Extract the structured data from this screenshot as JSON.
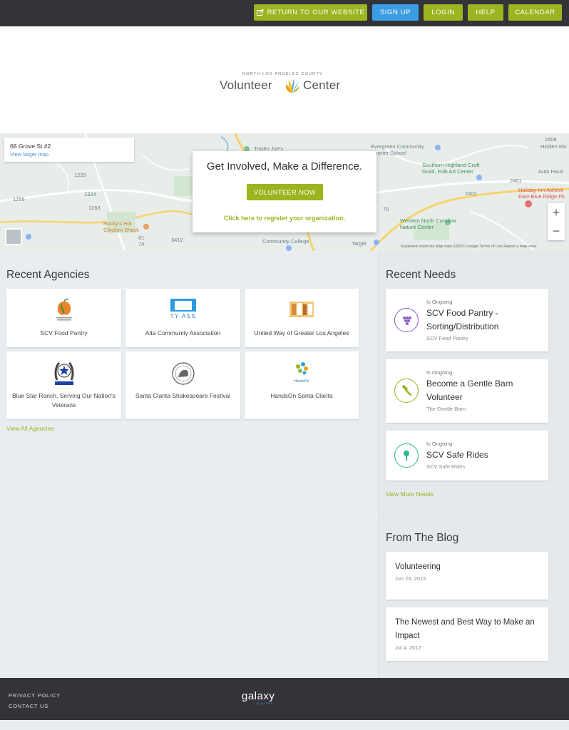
{
  "topbar": {
    "return_label": "RETURN TO OUR WEBSITE",
    "signup_label": "SIGN UP",
    "login_label": "LOGIN",
    "help_label": "HELP",
    "calendar_label": "CALENDAR"
  },
  "logo": {
    "small": "NORTH LOS ANGELES COUNTY",
    "part1": "Volunteer",
    "part2": "Center"
  },
  "map": {
    "address": "68 Grove St #2",
    "view_larger": "View larger map",
    "labels": {
      "trader": "Trader Joe's",
      "evergreen": "Evergreen Community Charter School",
      "southern": "Southern Highland Craft Guild, Folk Art Center",
      "auto": "Auto Haus",
      "hidden": "Hidden Riv",
      "holiday": "Holiday Inn Ashevil East-Blue Ridge Pk",
      "western": "Western North Carolina Nature Center",
      "rocky": "Rocky's Hot Chicken Shack",
      "community": "Community College",
      "target": "Target",
      "r1229": "1229",
      "r1324": "1324",
      "r1263": "1263",
      "r1255": "1255",
      "r3412": "3412",
      "r2408": "2408",
      "r2402": "2402",
      "r2401": "2401",
      "r70": "70",
      "r74": "74",
      "r81": "81"
    },
    "footer": "Keyboard shortcuts    Map data ©2023 Google    Terms of Use    Report a map error",
    "zoom_in": "+",
    "zoom_out": "−"
  },
  "cta": {
    "title": "Get Involved, Make a Difference.",
    "button": "VOLUNTEER NOW",
    "link": "Click here to register your organization."
  },
  "agencies": {
    "heading": "Recent Agencies",
    "items": [
      {
        "name": "SCV Food Pantry",
        "logo_text": "SCV FOOD PANTRY"
      },
      {
        "name": "Alta Community Association",
        "logo_text": "TY ASS"
      },
      {
        "name": "United Way of Greater Los Angeles",
        "logo_text": ""
      },
      {
        "name": "Blue Star Ranch, Serving Our Nation's Veterans",
        "logo_text": ""
      },
      {
        "name": "Santa Clarita Shakespeare Festival",
        "logo_text": ""
      },
      {
        "name": "HandsOn Santa Clarita",
        "logo_text": "HandsOn"
      }
    ],
    "view_all": "View All Agencies"
  },
  "needs": {
    "heading": "Recent Needs",
    "items": [
      {
        "status": "Is Ongoing",
        "name": "SCV Food Pantry - Sorting/Distribution",
        "org": "SCV Food Pantry",
        "icon": "grapes-icon",
        "color": "#8a5cc7"
      },
      {
        "status": "Is Ongoing",
        "name": "Become a Gentle Barn Volunteer",
        "org": "The Gentle Barn",
        "icon": "hammer-icon",
        "color": "#9ab520"
      },
      {
        "status": "Is Ongoing",
        "name": "SCV Safe Rides",
        "org": "SCV Safe Rides",
        "icon": "microphone-icon",
        "color": "#2fb58a"
      }
    ],
    "view_more": "View More Needs"
  },
  "blog": {
    "heading": "From The Blog",
    "posts": [
      {
        "title": "Volunteering",
        "date": "Jun 25, 2015"
      },
      {
        "title": "The Newest and Best Way to Make an Impact",
        "date": "Jul 4, 2012"
      }
    ]
  },
  "footer": {
    "privacy": "PRIVACY POLICY",
    "contact": "CONTACT US",
    "brand": "galaxy",
    "brand_sub": "digital"
  },
  "colors": {
    "accent_green": "#9ab520",
    "accent_blue": "#3b9de4",
    "dark_bar": "#333338"
  }
}
